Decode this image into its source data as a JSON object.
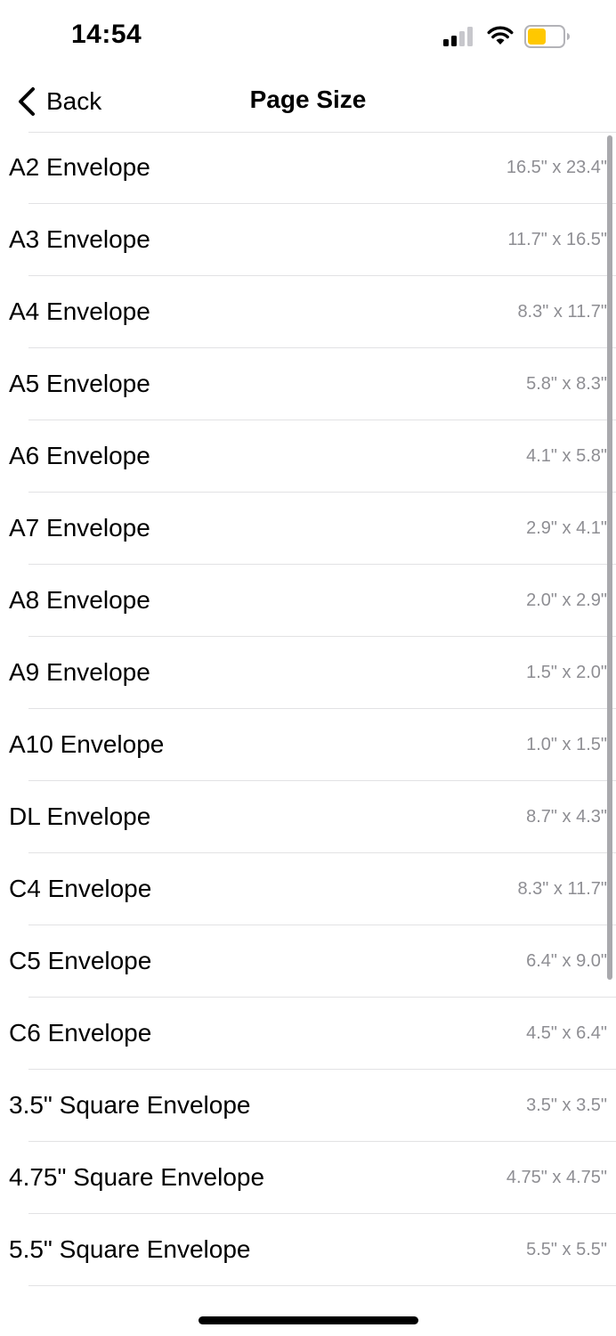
{
  "status_bar": {
    "time": "14:54",
    "battery_color": "#ffc800"
  },
  "nav": {
    "back_label": "Back",
    "title": "Page Size"
  },
  "sizes": [
    {
      "label": "A2 Envelope",
      "value": "16.5\" x 23.4\""
    },
    {
      "label": "A3 Envelope",
      "value": "11.7\" x 16.5\""
    },
    {
      "label": "A4 Envelope",
      "value": "8.3\" x 11.7\""
    },
    {
      "label": "A5 Envelope",
      "value": "5.8\" x 8.3\""
    },
    {
      "label": "A6 Envelope",
      "value": "4.1\" x 5.8\""
    },
    {
      "label": "A7 Envelope",
      "value": "2.9\" x 4.1\""
    },
    {
      "label": "A8 Envelope",
      "value": "2.0\" x 2.9\""
    },
    {
      "label": "A9 Envelope",
      "value": "1.5\" x 2.0\""
    },
    {
      "label": "A10 Envelope",
      "value": "1.0\" x 1.5\""
    },
    {
      "label": "DL Envelope",
      "value": "8.7\" x 4.3\""
    },
    {
      "label": "C4 Envelope",
      "value": "8.3\" x 11.7\""
    },
    {
      "label": "C5 Envelope",
      "value": "6.4\" x 9.0\""
    },
    {
      "label": "C6 Envelope",
      "value": "4.5\" x 6.4\""
    },
    {
      "label": "3.5\" Square Envelope",
      "value": "3.5\" x 3.5\""
    },
    {
      "label": "4.75\" Square Envelope",
      "value": "4.75\" x 4.75\""
    },
    {
      "label": "5.5\" Square Envelope",
      "value": "5.5\" x 5.5\""
    }
  ]
}
